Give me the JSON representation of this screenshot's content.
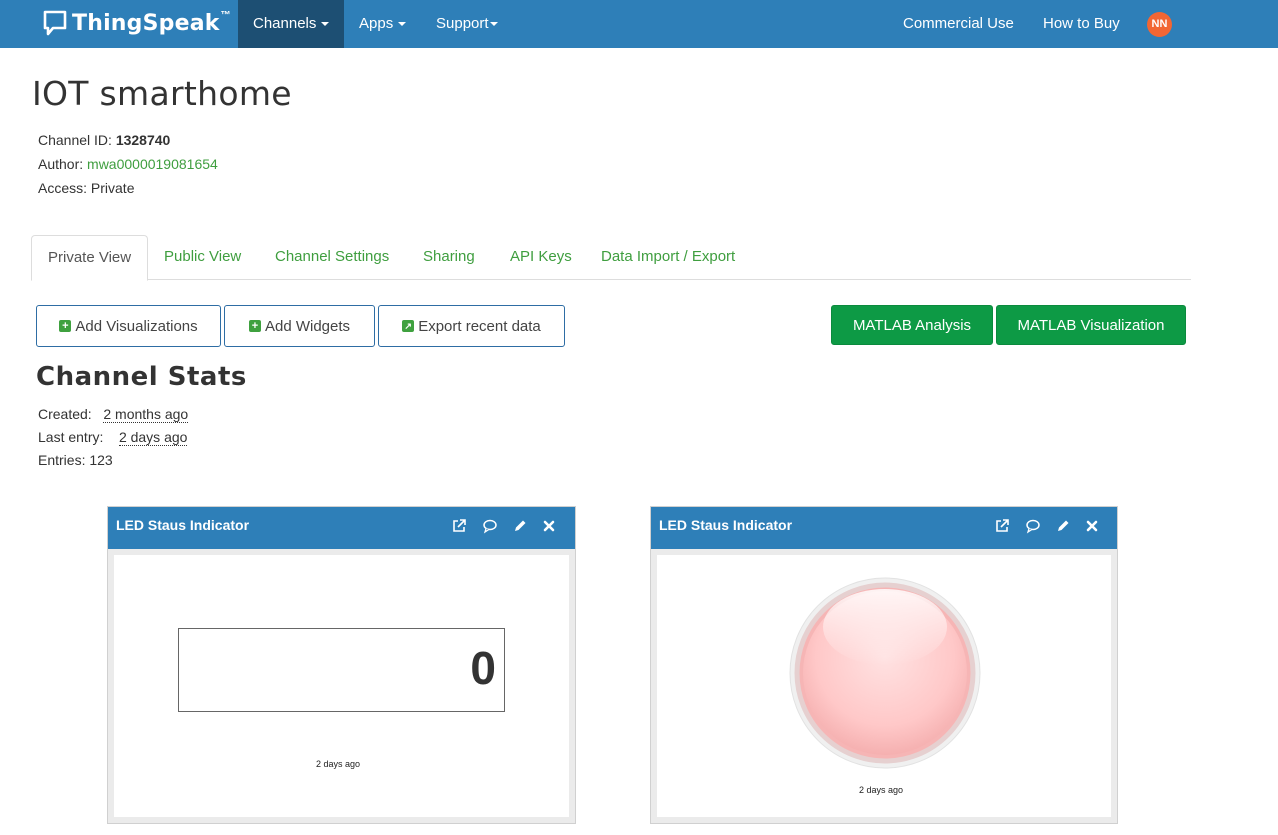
{
  "navbar": {
    "brand": "ThingSpeak",
    "trademark": "™",
    "items": [
      {
        "label": "Channels",
        "active": true
      },
      {
        "label": "Apps"
      },
      {
        "label": "Support"
      }
    ],
    "right_items": [
      {
        "label": "Commercial Use"
      },
      {
        "label": "How to Buy"
      }
    ],
    "avatar_initials": "NN",
    "colors": {
      "bar": "#2e7fb8",
      "active": "#1d4f73",
      "avatar": "#f26633"
    }
  },
  "channel": {
    "title": "IOT smarthome",
    "id_label": "Channel ID:",
    "id_value": "1328740",
    "author_label": "Author:",
    "author_value": "mwa0000019081654",
    "access_label": "Access:",
    "access_value": "Private"
  },
  "tabs": [
    {
      "label": "Private View",
      "active": true
    },
    {
      "label": "Public View"
    },
    {
      "label": "Channel Settings"
    },
    {
      "label": "Sharing"
    },
    {
      "label": "API Keys"
    },
    {
      "label": "Data Import / Export"
    }
  ],
  "actions": {
    "add_visualizations": "Add Visualizations",
    "add_widgets": "Add Widgets",
    "export_recent": "Export recent data",
    "matlab_analysis": "MATLAB Analysis",
    "matlab_visualization": "MATLAB Visualization"
  },
  "stats": {
    "title": "Channel Stats",
    "created_label": "Created:",
    "created_value": "2 months ago",
    "last_entry_label": "Last entry:",
    "last_entry_value": "2 days ago",
    "entries_label": "Entries:",
    "entries_value": "123"
  },
  "widgets": [
    {
      "title": "LED Staus Indicator",
      "type": "numeric",
      "value": "0",
      "timestamp": "2 days ago"
    },
    {
      "title": "LED Staus Indicator",
      "type": "lamp",
      "state": "off",
      "lamp_color": "#ffc4c4",
      "timestamp": "2 days ago"
    }
  ]
}
